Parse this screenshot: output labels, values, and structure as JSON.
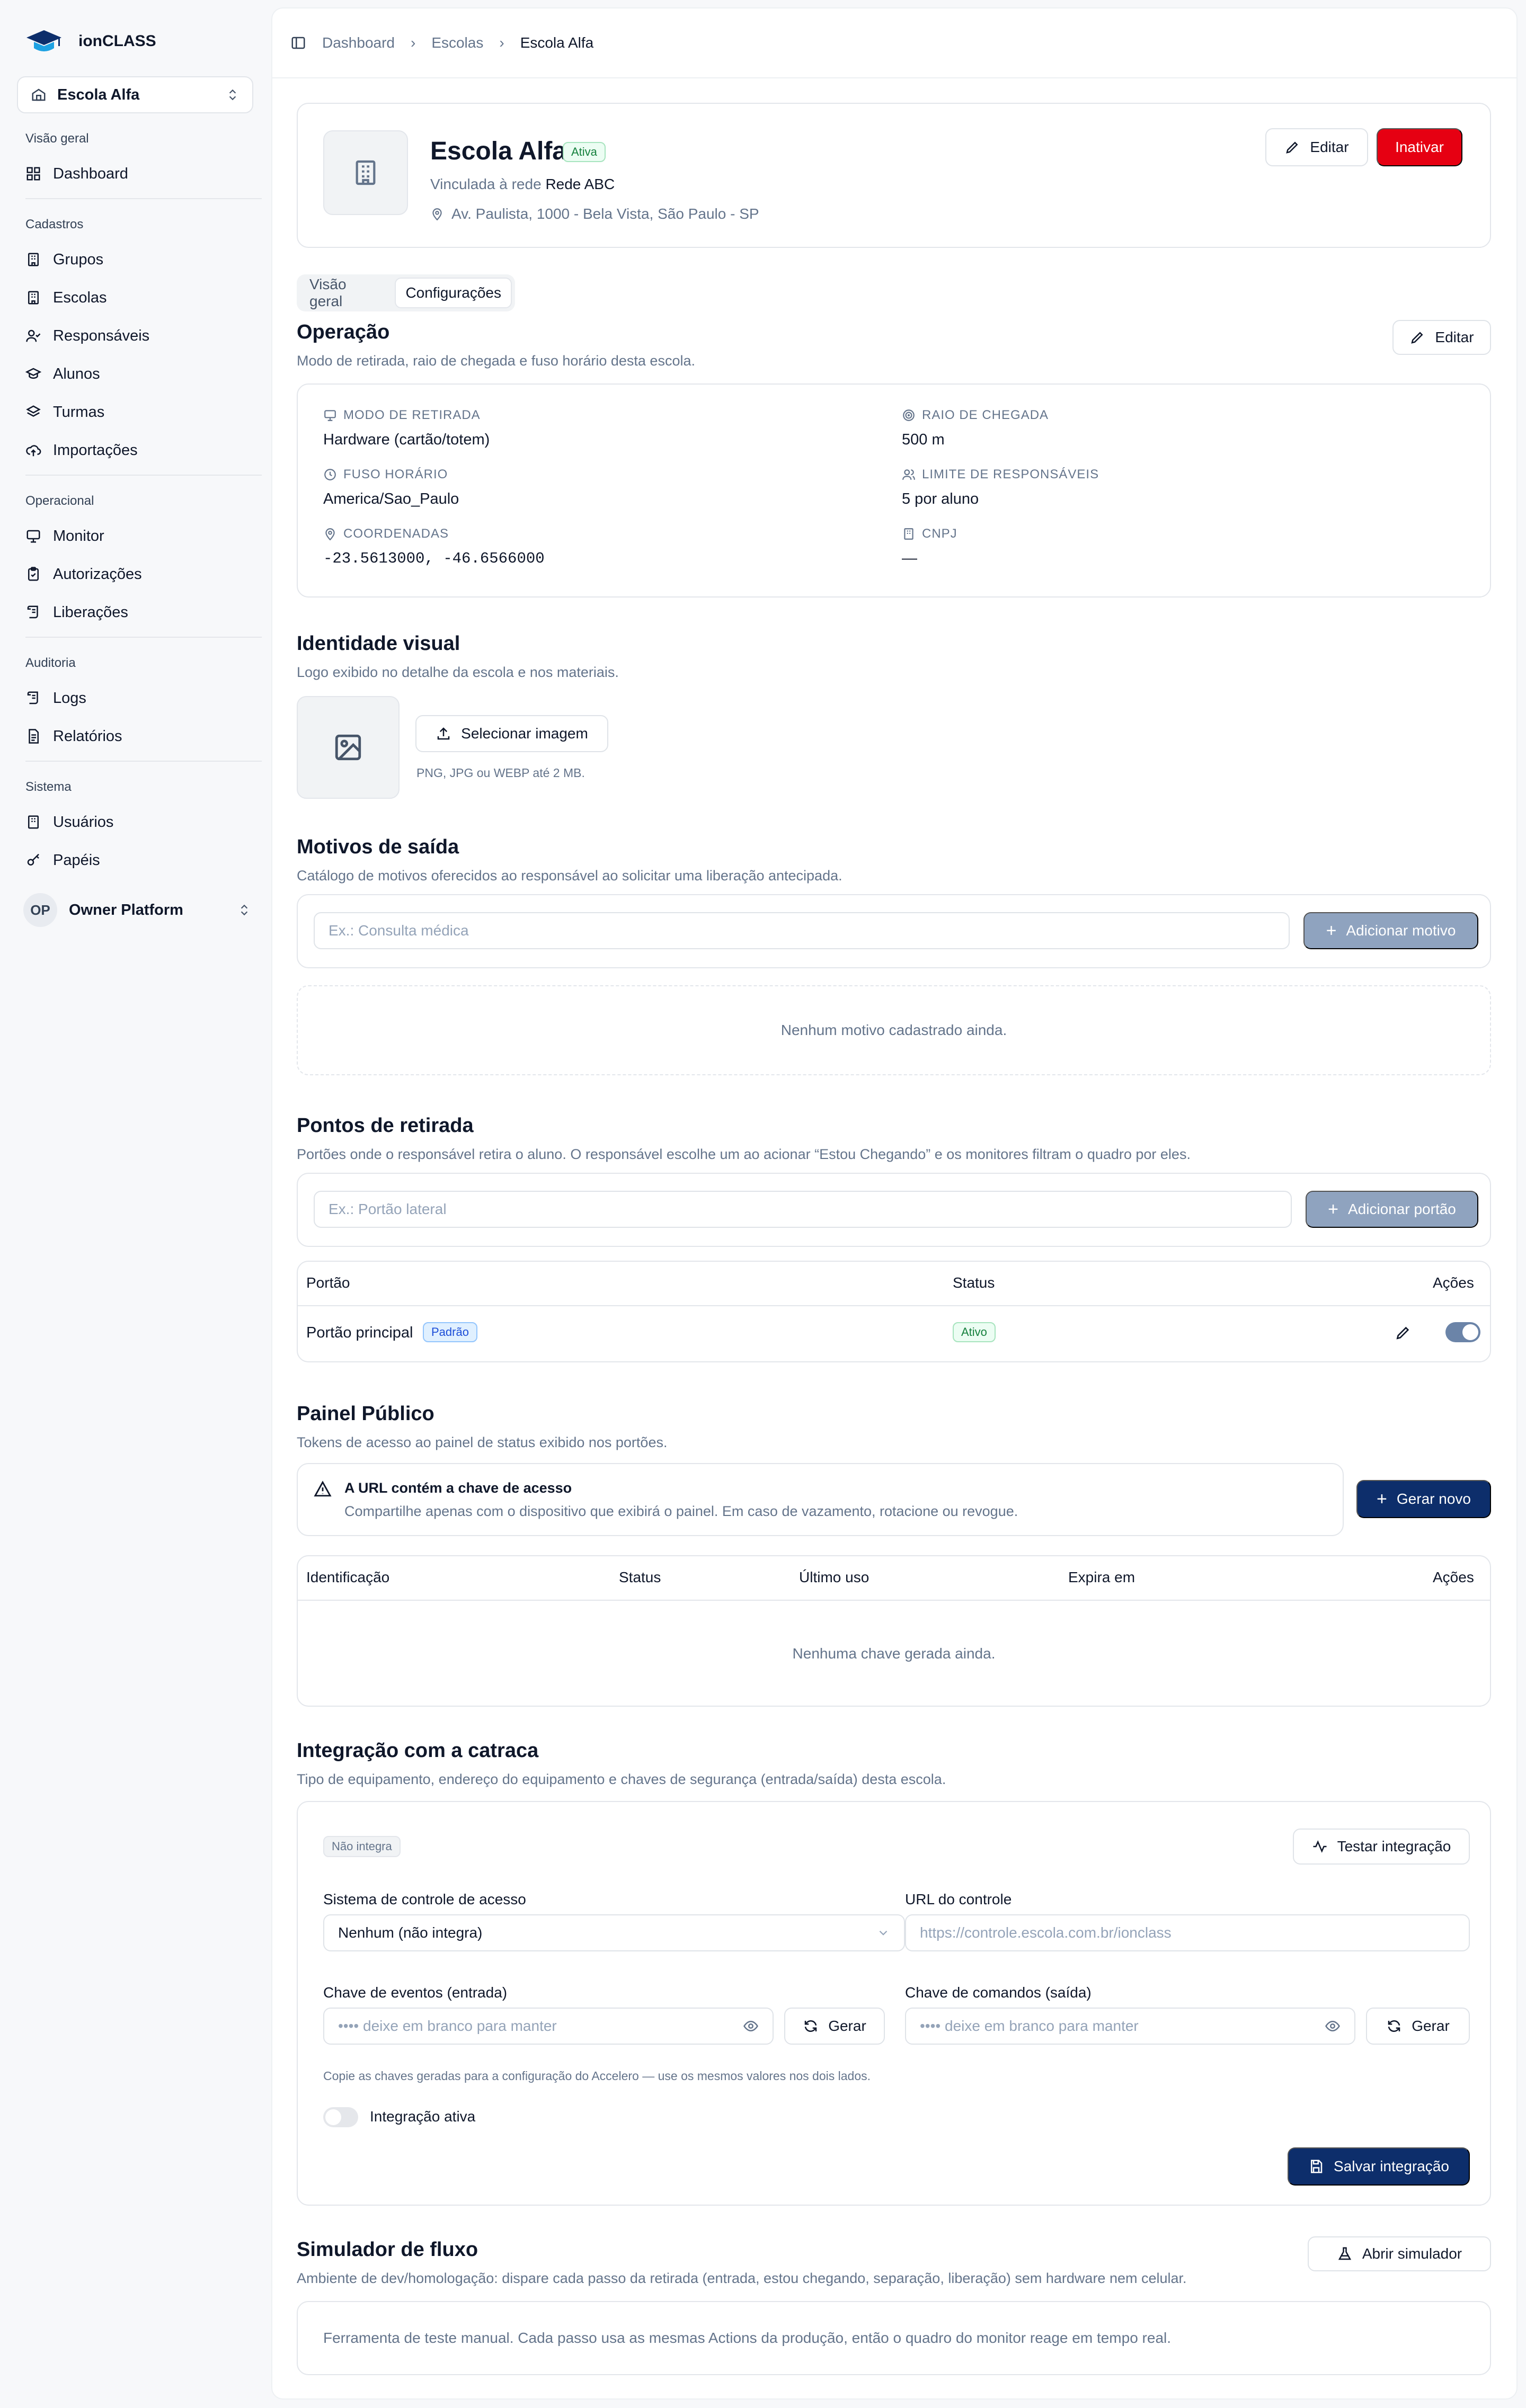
{
  "brand": {
    "name": "ionCLASS"
  },
  "school_switcher": {
    "value": "Escola Alfa"
  },
  "sidebar": {
    "groups": [
      {
        "label": "Visão geral",
        "items": [
          {
            "label": "Dashboard",
            "icon": "layout-grid-icon"
          }
        ]
      },
      {
        "label": "Cadastros",
        "items": [
          {
            "label": "Grupos",
            "icon": "building-icon"
          },
          {
            "label": "Escolas",
            "icon": "building-icon"
          },
          {
            "label": "Responsáveis",
            "icon": "user-check-icon"
          },
          {
            "label": "Alunos",
            "icon": "graduation-cap-icon"
          },
          {
            "label": "Turmas",
            "icon": "layers-icon"
          },
          {
            "label": "Importações",
            "icon": "cloud-upload-icon"
          }
        ]
      },
      {
        "label": "Operacional",
        "items": [
          {
            "label": "Monitor",
            "icon": "monitor-icon"
          },
          {
            "label": "Autorizações",
            "icon": "clipboard-check-icon"
          },
          {
            "label": "Liberações",
            "icon": "scroll-icon"
          }
        ]
      },
      {
        "label": "Auditoria",
        "items": [
          {
            "label": "Logs",
            "icon": "scroll-icon"
          },
          {
            "label": "Relatórios",
            "icon": "file-text-icon"
          }
        ]
      },
      {
        "label": "Sistema",
        "items": [
          {
            "label": "Usuários",
            "icon": "users-icon"
          },
          {
            "label": "Papéis",
            "icon": "key-icon"
          }
        ]
      }
    ],
    "user": {
      "initials": "OP",
      "name": "Owner Platform"
    }
  },
  "breadcrumb": [
    "Dashboard",
    "Escolas",
    "Escola Alfa"
  ],
  "school": {
    "name": "Escola Alfa",
    "status": "Ativa",
    "network_prefix": "Vinculada à rede",
    "network": "Rede ABC",
    "address": "Av. Paulista, 1000 - Bela Vista, São Paulo - SP",
    "edit_label": "Editar",
    "deactivate_label": "Inativar"
  },
  "tabs": [
    {
      "label": "Visão geral",
      "active": false
    },
    {
      "label": "Configurações",
      "active": true
    }
  ],
  "operation": {
    "title": "Operação",
    "subtitle": "Modo de retirada, raio de chegada e fuso horário desta escola.",
    "edit_label": "Editar",
    "fields": {
      "mode_label": "MODO DE RETIRADA",
      "mode_value": "Hardware (cartão/totem)",
      "radius_label": "RAIO DE CHEGADA",
      "radius_value": "500 m",
      "tz_label": "FUSO HORÁRIO",
      "tz_value": "America/Sao_Paulo",
      "limit_label": "LIMITE DE RESPONSÁVEIS",
      "limit_value": "5 por aluno",
      "coords_label": "COORDENADAS",
      "coords_value": "-23.5613000, -46.6566000",
      "cnpj_label": "CNPJ",
      "cnpj_value": "—"
    }
  },
  "identity": {
    "title": "Identidade visual",
    "subtitle": "Logo exibido no detalhe da escola e nos materiais.",
    "button": "Selecionar imagem",
    "hint": "PNG, JPG ou WEBP até 2 MB."
  },
  "reasons": {
    "title": "Motivos de saída",
    "subtitle": "Catálogo de motivos oferecidos ao responsável ao solicitar uma liberação antecipada.",
    "placeholder": "Ex.: Consulta médica",
    "add_label": "Adicionar motivo",
    "empty": "Nenhum motivo cadastrado ainda."
  },
  "pickup": {
    "title": "Pontos de retirada",
    "subtitle": "Portões onde o responsável retira o aluno. O responsável escolhe um ao acionar “Estou Chegando” e os monitores filtram o quadro por eles.",
    "placeholder": "Ex.: Portão lateral",
    "add_label": "Adicionar portão",
    "columns": [
      "Portão",
      "Status",
      "Ações"
    ],
    "rows": [
      {
        "name": "Portão principal",
        "tag": "Padrão",
        "status": "Ativo",
        "enabled": true
      }
    ]
  },
  "panel": {
    "title": "Painel Público",
    "subtitle": "Tokens de acesso ao painel de status exibido nos portões.",
    "warning_title": "A URL contém a chave de acesso",
    "warning_text": "Compartilhe apenas com o dispositivo que exibirá o painel. Em caso de vazamento, rotacione ou revogue.",
    "new_label": "Gerar novo",
    "columns": [
      "Identificação",
      "Status",
      "Último uso",
      "Expira em",
      "Ações"
    ],
    "empty": "Nenhuma chave gerada ainda."
  },
  "turnstile": {
    "title": "Integração com a catraca",
    "subtitle": "Tipo de equipamento, endereço do equipamento e chaves de segurança (entrada/saída) desta escola.",
    "badge": "Não integra",
    "test_label": "Testar integração",
    "system_label": "Sistema de controle de acesso",
    "system_value": "Nenhum (não integra)",
    "url_label": "URL do controle",
    "url_placeholder": "https://controle.escola.com.br/ionclass",
    "events_label": "Chave de eventos (entrada)",
    "commands_label": "Chave de comandos (saída)",
    "key_placeholder": "•••• deixe em branco para manter",
    "generate_label": "Gerar",
    "copy_hint": "Copie as chaves geradas para a configuração do Accelero — use os mesmos valores nos dois lados.",
    "active_label": "Integração ativa",
    "active": false,
    "save_label": "Salvar integração"
  },
  "simulator": {
    "title": "Simulador de fluxo",
    "subtitle": "Ambiente de dev/homologação: dispare cada passo da retirada (entrada, estou chegando, separação, liberação) sem hardware nem celular.",
    "open_label": "Abrir simulador",
    "body": "Ferramenta de teste manual. Cada passo usa as mesmas Actions da produção, então o quadro do monitor reage em tempo real."
  }
}
